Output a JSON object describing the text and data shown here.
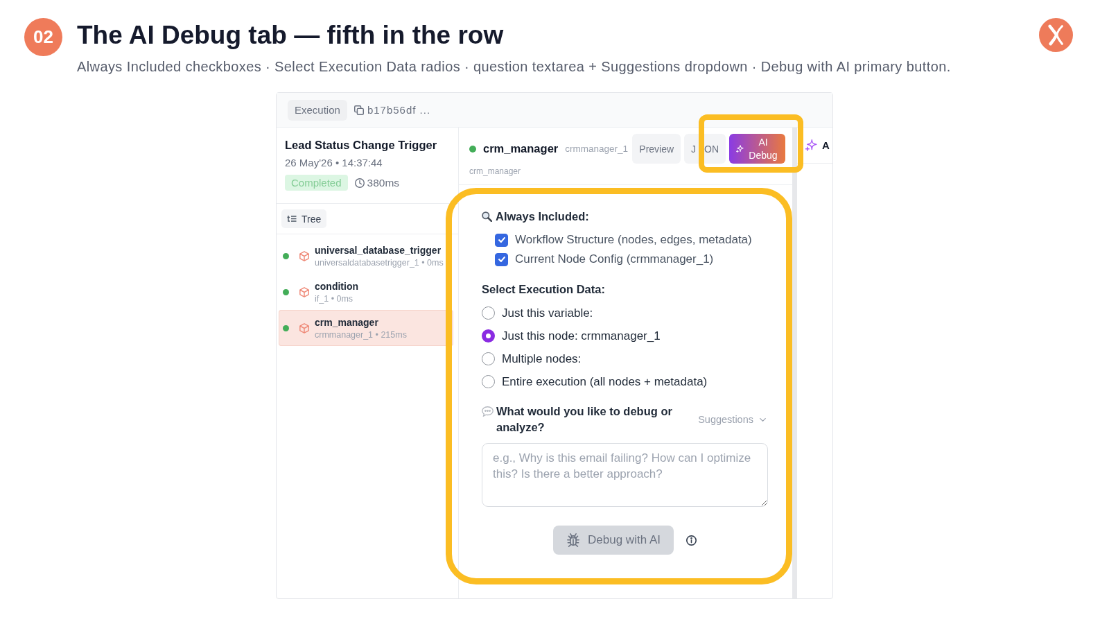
{
  "slide": {
    "number": "02",
    "title": "The AI Debug tab — fifth in the row",
    "subtitle": "Always Included checkboxes · Select Execution Data radios · question textarea + Suggestions dropdown · Debug with AI primary button."
  },
  "top_bar": {
    "label": "Execution",
    "run_id": "b17b56df ..."
  },
  "run": {
    "title": "Lead Status Change Trigger",
    "timestamp": "26 May'26 • 14:37:44",
    "status": "Completed",
    "duration": "380ms"
  },
  "view_toggle": {
    "label": "Tree"
  },
  "nodes": [
    {
      "name": "universal_database_trigger",
      "meta": "universaldatabasetrigger_1 • 0ms",
      "selected": false
    },
    {
      "name": "condition",
      "meta": "if_1 • 0ms",
      "selected": false
    },
    {
      "name": "crm_manager",
      "meta": "crmmanager_1 • 215ms",
      "selected": true
    }
  ],
  "node_panel": {
    "name": "crm_manager",
    "id": "crmmanager_1",
    "type": "crm_manager",
    "tabs": [
      {
        "label": "Preview",
        "kind": "plain",
        "selected": false,
        "highlighted": false
      },
      {
        "label": "J ON",
        "kind": "plain",
        "selected": false,
        "highlighted": false
      },
      {
        "label": "AI Debug",
        "kind": "ai",
        "selected": true,
        "highlighted": true
      }
    ],
    "side_tab": {
      "label": "A"
    }
  },
  "form": {
    "highlighted": true,
    "always_included": {
      "title": "Always Included:",
      "items": [
        {
          "label": "Workflow Structure (nodes, edges, metadata)",
          "checked": true
        },
        {
          "label": "Current Node Config (crmmanager_1)",
          "checked": true
        }
      ]
    },
    "execution_data": {
      "title": "Select Execution Data:",
      "options": [
        {
          "label": "Just this variable:",
          "selected": false
        },
        {
          "label": "Just this node: crmmanager_1",
          "selected": true
        },
        {
          "label": "Multiple nodes:",
          "selected": false
        },
        {
          "label": "Entire execution (all nodes + metadata)",
          "selected": false
        }
      ]
    },
    "question": {
      "label": "What would you like to debug or analyze?",
      "suggestions": "Suggestions",
      "placeholder": "e.g., Why is this email failing? How can I optimize this? Is there a better approach?"
    },
    "submit": {
      "label": "Debug with AI",
      "disabled": true
    }
  }
}
